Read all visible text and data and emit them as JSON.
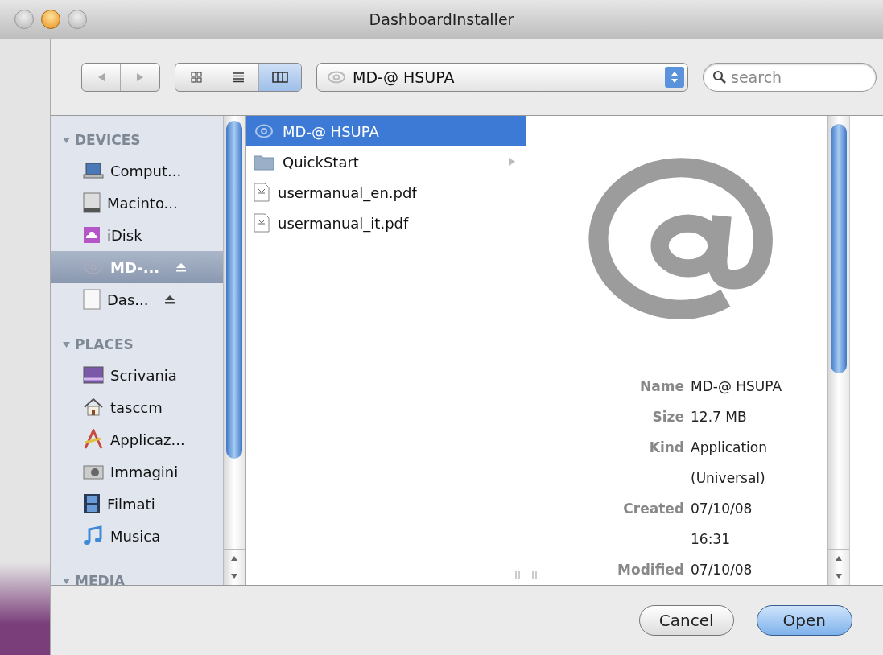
{
  "window": {
    "title": "DashboardInstaller"
  },
  "toolbar": {
    "nav": [
      {
        "kind": "back",
        "disabled": true
      },
      {
        "kind": "forward",
        "disabled": true
      }
    ],
    "views": [
      {
        "kind": "icons",
        "selected": false
      },
      {
        "kind": "list",
        "selected": false
      },
      {
        "kind": "columns",
        "selected": true
      }
    ],
    "location": "MD-@ HSUPA",
    "search": {
      "placeholder": "search"
    }
  },
  "sidebar": {
    "sections": [
      {
        "title": "DEVICES",
        "expanded": true,
        "items": [
          {
            "label": "Comput...",
            "kind": "computer",
            "selected": false,
            "eject": false
          },
          {
            "label": "Macinto...",
            "kind": "disk",
            "selected": false,
            "eject": false
          },
          {
            "label": "iDisk",
            "kind": "idisk",
            "selected": false,
            "eject": false
          },
          {
            "label": "MD-...",
            "kind": "at",
            "selected": true,
            "eject": true
          },
          {
            "label": "Das...",
            "kind": "volume",
            "selected": false,
            "eject": true
          }
        ]
      },
      {
        "title": "PLACES",
        "expanded": true,
        "items": [
          {
            "label": "Scrivania",
            "kind": "desktop",
            "selected": false,
            "eject": false
          },
          {
            "label": "tasccm",
            "kind": "home",
            "selected": false,
            "eject": false
          },
          {
            "label": "Applicaz...",
            "kind": "apps",
            "selected": false,
            "eject": false
          },
          {
            "label": "Immagini",
            "kind": "pictures",
            "selected": false,
            "eject": false
          },
          {
            "label": "Filmati",
            "kind": "movies",
            "selected": false,
            "eject": false
          },
          {
            "label": "Musica",
            "kind": "music",
            "selected": false,
            "eject": false
          }
        ]
      },
      {
        "title": "MEDIA",
        "expanded": true
      }
    ]
  },
  "files": [
    {
      "name": "MD-@ HSUPA",
      "kind": "app",
      "selected": true,
      "has_children": false
    },
    {
      "name": "QuickStart",
      "kind": "folder",
      "selected": false,
      "has_children": true
    },
    {
      "name": "usermanual_en.pdf",
      "kind": "pdf",
      "selected": false,
      "has_children": false
    },
    {
      "name": "usermanual_it.pdf",
      "kind": "pdf",
      "selected": false,
      "has_children": false
    }
  ],
  "preview": {
    "fields": [
      {
        "label": "Name",
        "lines": [
          "MD-@ HSUPA"
        ]
      },
      {
        "label": "Size",
        "lines": [
          "12.7 MB"
        ]
      },
      {
        "label": "Kind",
        "lines": [
          "Application",
          "(Universal)"
        ]
      },
      {
        "label": "Created",
        "lines": [
          "07/10/08",
          "16:31"
        ]
      },
      {
        "label": "Modified",
        "lines": [
          "07/10/08"
        ]
      }
    ]
  },
  "buttons": [
    {
      "label": "Cancel",
      "default": false
    },
    {
      "label": "Open",
      "default": true
    }
  ]
}
